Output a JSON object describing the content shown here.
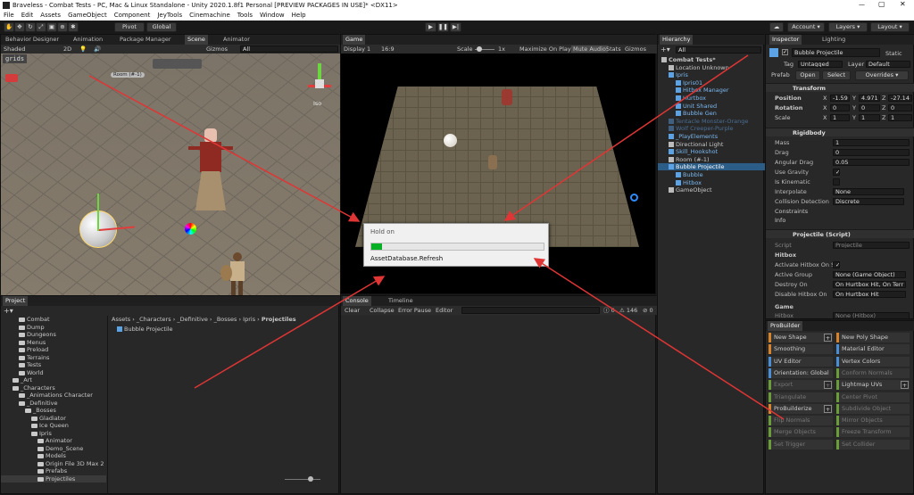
{
  "window": {
    "title": "Braveless - Combat Tests - PC, Mac & Linux Standalone - Unity 2020.1.8f1 Personal [PREVIEW PACKAGES IN USE]* <DX11>"
  },
  "menu": [
    "File",
    "Edit",
    "Assets",
    "GameObject",
    "Component",
    "JeyTools",
    "Cinemachine",
    "Tools",
    "Window",
    "Help"
  ],
  "toolbar": {
    "pivot": "Pivot",
    "global": "Global",
    "account": "Account",
    "layers": "Layers",
    "layout": "Layout"
  },
  "scene_tabs": [
    "Behavior Designer",
    "Animation",
    "Package Manager",
    "Scene",
    "Animator"
  ],
  "scene": {
    "shading": "Shaded",
    "mode2d": "2D",
    "gizmos": "Gizmos",
    "search": "All",
    "grids": "grids",
    "room_label": "Room (#-1)",
    "persp": "Iso"
  },
  "game": {
    "tab": "Game",
    "display": "Display 1",
    "aspect": "16:9",
    "scale_label": "Scale",
    "scale_value": "1x",
    "max": "Maximize On Play",
    "mute": "Mute Audio",
    "stats": "Stats",
    "gizmos": "Gizmos"
  },
  "dialog": {
    "title": "Hold on",
    "message": "AssetDatabase.Refresh",
    "progress": 0.06
  },
  "hierarchy": {
    "tab": "Hierarchy",
    "search": "All",
    "items": [
      {
        "label": "Combat Tests*",
        "indent": 0,
        "kind": "scene"
      },
      {
        "label": "Location Unknown",
        "indent": 1,
        "kind": "obj"
      },
      {
        "label": "Ipris",
        "indent": 1,
        "kind": "prefab"
      },
      {
        "label": "Ipris01",
        "indent": 2,
        "kind": "prefab"
      },
      {
        "label": "Hitbox Manager",
        "indent": 2,
        "kind": "prefab"
      },
      {
        "label": "Hurtbox",
        "indent": 2,
        "kind": "prefab"
      },
      {
        "label": "Unit Shared",
        "indent": 2,
        "kind": "prefab"
      },
      {
        "label": "Bubble Gen",
        "indent": 2,
        "kind": "prefab"
      },
      {
        "label": "Tentacle Monster-Orange",
        "indent": 1,
        "kind": "faded"
      },
      {
        "label": "Wolf Creeper-Purple",
        "indent": 1,
        "kind": "faded"
      },
      {
        "label": "_PlayElements",
        "indent": 1,
        "kind": "prefab"
      },
      {
        "label": "Directional Light",
        "indent": 1,
        "kind": "obj"
      },
      {
        "label": "Skill_Hookshot",
        "indent": 1,
        "kind": "prefab"
      },
      {
        "label": "Room (#-1)",
        "indent": 1,
        "kind": "obj"
      },
      {
        "label": "Bubble Projectile",
        "indent": 1,
        "kind": "selected"
      },
      {
        "label": "Bubble",
        "indent": 2,
        "kind": "prefab"
      },
      {
        "label": "Hitbox",
        "indent": 2,
        "kind": "prefab"
      },
      {
        "label": "GameObject",
        "indent": 1,
        "kind": "obj"
      }
    ]
  },
  "inspector": {
    "tabs": [
      "Inspector",
      "Lighting"
    ],
    "name": "Bubble Projectile",
    "static": "Static",
    "tag_label": "Tag",
    "tag": "Untagged",
    "layer_label": "Layer",
    "layer": "Default",
    "prefab_label": "Prefab",
    "open": "Open",
    "select": "Select",
    "overrides": "Overrides",
    "transform": {
      "title": "Transform",
      "position": "Position",
      "rotation": "Rotation",
      "scale": "Scale",
      "px": "-1.59",
      "py": "4.971",
      "pz": "-27.14",
      "rx": "0",
      "ry": "0",
      "rz": "0",
      "sx": "1",
      "sy": "1",
      "sz": "1"
    },
    "rigidbody": {
      "title": "Rigidbody",
      "rows": [
        [
          "Mass",
          "1"
        ],
        [
          "Drag",
          "0"
        ],
        [
          "Angular Drag",
          "0.05"
        ],
        [
          "Use Gravity",
          "✓"
        ],
        [
          "Is Kinematic",
          ""
        ],
        [
          "Interpolate",
          "None"
        ],
        [
          "Collision Detection",
          "Discrete"
        ]
      ],
      "constraints": "Constraints",
      "info": "Info"
    },
    "projectile": {
      "title": "Projectile (Script)",
      "script_label": "Script",
      "script": "Projectile",
      "hitbox": "Hitbox",
      "rows": [
        [
          "Activate Hitbox On S",
          "✓"
        ],
        [
          "Active Group",
          "None (Game Object)"
        ],
        [
          "Destroy On",
          "On Hurtbox Hit, On Terr"
        ],
        [
          "Disable Hitbox On",
          "On Hurtbox Hit"
        ]
      ],
      "game": "Game",
      "hitbox2_label": "Hitbox",
      "hitbox2": "None (Hitbox)"
    }
  },
  "probuilder": {
    "tab": "ProBuilder",
    "left": [
      "New Shape",
      "Smoothing",
      "UV Editor",
      "Orientation: Global",
      "Export",
      "Triangulate",
      "ProBuilderize",
      "Flip Normals",
      "Merge Objects",
      "Set Trigger"
    ],
    "right": [
      "New Poly Shape",
      "Material Editor",
      "Vertex Colors",
      "Conform Normals",
      "Lightmap UVs",
      "Center Pivot",
      "Subdivide Object",
      "Mirror Objects",
      "Freeze Transform",
      "Set Collider"
    ]
  },
  "project": {
    "tab": "Project",
    "breadcrumb": [
      "Assets",
      "_Characters",
      "_Definitive",
      "_Bosses",
      "Ipris",
      "Projectiles"
    ],
    "file": "Bubble Projectile",
    "tree": [
      {
        "label": "Combat",
        "indent": 2
      },
      {
        "label": "Dump",
        "indent": 2
      },
      {
        "label": "Dungeons",
        "indent": 2
      },
      {
        "label": "Menus",
        "indent": 2
      },
      {
        "label": "Preload",
        "indent": 2
      },
      {
        "label": "Terrains",
        "indent": 2
      },
      {
        "label": "Tests",
        "indent": 2
      },
      {
        "label": "World",
        "indent": 2
      },
      {
        "label": "_Art",
        "indent": 1
      },
      {
        "label": "_Characters",
        "indent": 1
      },
      {
        "label": "_Animations Character",
        "indent": 2
      },
      {
        "label": "_Definitive",
        "indent": 2
      },
      {
        "label": "_Bosses",
        "indent": 3
      },
      {
        "label": "Gladiator",
        "indent": 4
      },
      {
        "label": "Ice Queen",
        "indent": 4
      },
      {
        "label": "Ipris",
        "indent": 4
      },
      {
        "label": "Animator",
        "indent": 5
      },
      {
        "label": "Demo_Scene",
        "indent": 5
      },
      {
        "label": "Models",
        "indent": 5
      },
      {
        "label": "Origin File 3D Max 2",
        "indent": 5
      },
      {
        "label": "Prefabs",
        "indent": 5
      },
      {
        "label": "Projectiles",
        "indent": 5
      }
    ]
  },
  "console": {
    "tabs": [
      "Console",
      "Timeline"
    ],
    "clear": "Clear",
    "collapse": "Collapse",
    "error_pause": "Error Pause",
    "editor": "Editor",
    "count_err": "0",
    "count_warn": "146",
    "count_info": "0"
  },
  "colors": {
    "arrow": "#e03535",
    "accent": "#2c5d87",
    "progress": "#06b025"
  }
}
